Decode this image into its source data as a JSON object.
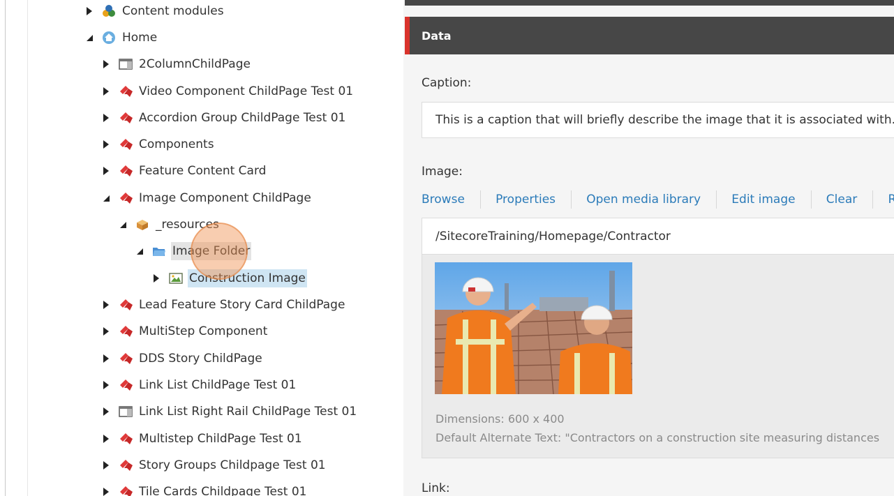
{
  "tree": {
    "items": [
      {
        "label": "Content modules",
        "icon": "modules-icon",
        "expanded": false
      },
      {
        "label": "Home",
        "icon": "home-icon",
        "expanded": true
      },
      {
        "label": "2ColumnChildPage",
        "icon": "page-layout-icon",
        "expanded": false
      },
      {
        "label": "Video Component ChildPage Test 01",
        "icon": "red-bookmark-icon",
        "expanded": false
      },
      {
        "label": "Accordion Group ChildPage Test 01",
        "icon": "red-bookmark-icon",
        "expanded": false
      },
      {
        "label": "Components",
        "icon": "red-bookmark-icon",
        "expanded": false
      },
      {
        "label": "Feature Content Card",
        "icon": "red-bookmark-icon",
        "expanded": false
      },
      {
        "label": "Image Component ChildPage",
        "icon": "red-bookmark-icon",
        "expanded": true
      },
      {
        "label": "_resources",
        "icon": "box-icon",
        "expanded": true
      },
      {
        "label": "Image Folder",
        "icon": "folder-icon",
        "expanded": true
      },
      {
        "label": "Construction Image",
        "icon": "image-icon",
        "expanded": false
      },
      {
        "label": "Lead Feature Story Card ChildPage",
        "icon": "red-bookmark-icon",
        "expanded": false
      },
      {
        "label": "MultiStep Component",
        "icon": "red-bookmark-icon",
        "expanded": false
      },
      {
        "label": "DDS Story ChildPage",
        "icon": "red-bookmark-icon",
        "expanded": false
      },
      {
        "label": "Link List ChildPage Test 01",
        "icon": "red-bookmark-icon",
        "expanded": false
      },
      {
        "label": "Link List Right Rail ChildPage Test 01",
        "icon": "page-layout-icon",
        "expanded": false
      },
      {
        "label": "Multistep ChildPage Test 01",
        "icon": "red-bookmark-icon",
        "expanded": false
      },
      {
        "label": "Story Groups Childpage Test 01",
        "icon": "red-bookmark-icon",
        "expanded": false
      },
      {
        "label": "Tile Cards Childpage Test 01",
        "icon": "red-bookmark-icon",
        "expanded": false
      }
    ]
  },
  "section": {
    "title": "Data"
  },
  "caption": {
    "label": "Caption:",
    "value": "This is a caption that will briefly describe the image that it is associated with."
  },
  "image": {
    "label": "Image:",
    "toolbar": [
      "Browse",
      "Properties",
      "Open media library",
      "Edit image",
      "Clear",
      "Re"
    ],
    "path": "/SitecoreTraining/Homepage/Contractor",
    "dimensions": "Dimensions: 600 x 400",
    "alt_text": "Default Alternate Text: \"Contractors on a construction site measuring distances"
  },
  "link": {
    "label": "Link:"
  },
  "colors": {
    "header_bg": "#474747",
    "accent": "#d9332c",
    "link": "#2b7bb9"
  }
}
